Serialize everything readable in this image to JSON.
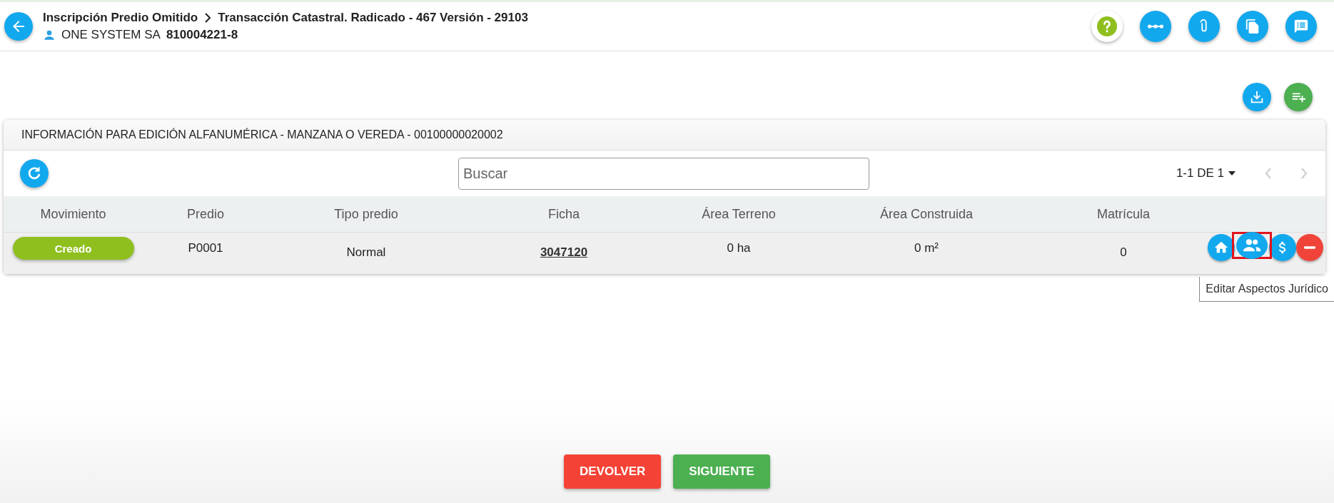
{
  "header": {
    "title": "Inscripción Predio Omitido",
    "subtitle": "Transacción Catastral. Radicado - 467 Versión - 29103",
    "owner": "ONE SYSTEM SA",
    "owner_id": "810004221-8"
  },
  "header_actions": [
    {
      "kind": "help"
    },
    {
      "kind": "flow"
    },
    {
      "kind": "attach"
    },
    {
      "kind": "documents"
    },
    {
      "kind": "comments"
    }
  ],
  "page_actions": [
    {
      "kind": "download"
    },
    {
      "kind": "add"
    }
  ],
  "card": {
    "title": "INFORMACIÓN PARA EDICIÓN ALFANUMÉRICA - MANZANA O VEREDA - 00100000020002",
    "search": {
      "placeholder": "Buscar"
    },
    "pagination": "1-1 DE 1",
    "columns": [
      "Movimiento",
      "Predio",
      "Tipo predio",
      "Ficha",
      "Área Terreno",
      "Área Construida",
      "Matrícula"
    ],
    "rows": [
      {
        "movimiento": "Creado",
        "predio": "P0001",
        "tipo_predio": "Normal",
        "ficha": "3047120",
        "area_terreno": "0 ha",
        "area_construida": "0 m²",
        "matricula": "0",
        "actions": [
          {
            "kind": "home",
            "highlighted": false
          },
          {
            "kind": "people",
            "highlighted": true
          },
          {
            "kind": "money",
            "highlighted": false
          },
          {
            "kind": "remove",
            "highlighted": false
          }
        ]
      }
    ]
  },
  "tooltip": "Editar Aspectos Jurídico",
  "buttons": [
    {
      "kind": "return",
      "label": "DEVOLVER"
    },
    {
      "kind": "next",
      "label": "SIGUIENTE"
    }
  ]
}
